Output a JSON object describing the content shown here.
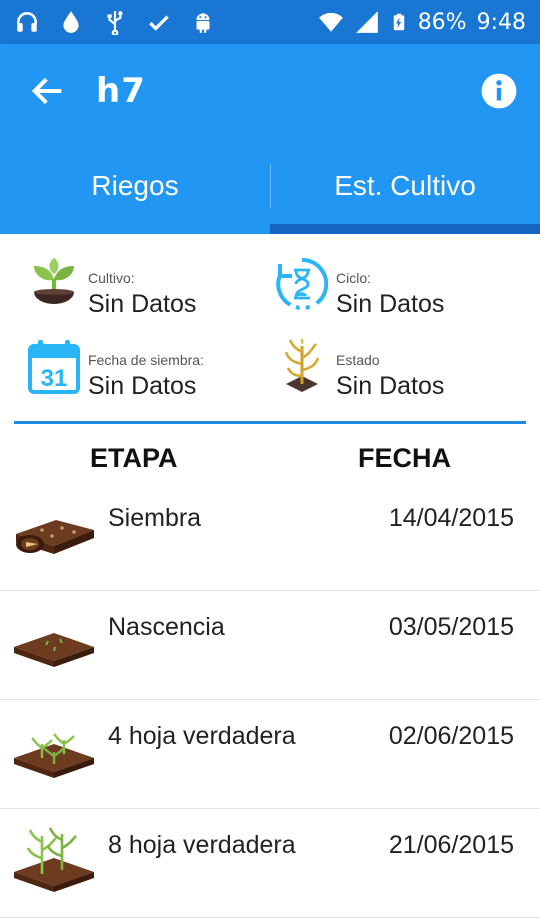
{
  "status_bar": {
    "battery": "86%",
    "time": "9:48"
  },
  "app_bar": {
    "title": "h7"
  },
  "tabs": [
    {
      "label": "Riegos",
      "active": false
    },
    {
      "label": "Est. Cultivo",
      "active": true
    }
  ],
  "crop_info": {
    "cultivo": {
      "label": "Cultivo:",
      "value": "Sin Datos",
      "icon": "sprout-icon"
    },
    "ciclo": {
      "label": "Ciclo:",
      "value": "Sin Datos",
      "icon": "hourglass-cycle-icon"
    },
    "fecha_siembra": {
      "label": "Fecha de siembra:",
      "value": "Sin Datos",
      "icon": "calendar-icon",
      "calendar_day": "31"
    },
    "estado": {
      "label": "Estado",
      "value": "Sin Datos",
      "icon": "dry-corn-icon"
    }
  },
  "table": {
    "headers": {
      "stage": "ETAPA",
      "date": "FECHA"
    },
    "rows": [
      {
        "stage": "Siembra",
        "date": "14/04/2015",
        "icon": "seeded-soil-icon"
      },
      {
        "stage": "Nascencia",
        "date": "03/05/2015",
        "icon": "sprouting-soil-icon"
      },
      {
        "stage": "4 hoja verdadera",
        "date": "02/06/2015",
        "icon": "small-plants-soil-icon"
      },
      {
        "stage": "8 hoja verdadera",
        "date": "21/06/2015",
        "icon": "tall-plants-soil-icon"
      }
    ]
  },
  "colors": {
    "primary": "#2196f3",
    "status_bar": "#1976d2",
    "tab_indicator": "#1565c0",
    "divider": "#1e88e5"
  }
}
